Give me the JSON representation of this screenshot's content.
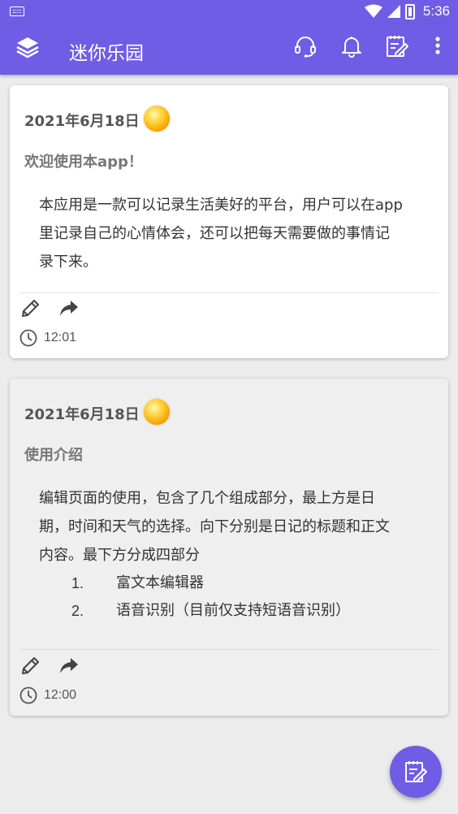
{
  "status_bar": {
    "time": "5:36"
  },
  "app_bar": {
    "title": "迷你乐园",
    "icons": [
      "layers-icon",
      "headset-icon",
      "bell-icon",
      "edit-note-icon",
      "more-vert-icon"
    ]
  },
  "colors": {
    "accent": "#6f5de6",
    "card_bg": "#ffffff",
    "page_bg": "#ececec"
  },
  "entries": [
    {
      "date": "2021年6月18日",
      "weather_icon": "sunny-icon",
      "title": "欢迎使用本app！",
      "body_lines": [
        "本应用是一款可以记录生活美好的平台，用户可以在app",
        "里记录自己的心情体会，还可以把每天需要做的事情记",
        "录下来。"
      ],
      "time": "12:01"
    },
    {
      "date": "2021年6月18日",
      "weather_icon": "sunny-icon",
      "title": "使用介绍",
      "body_lines": [
        "编辑页面的使用，包含了几个组成部分，最上方是日",
        "期，时间和天气的选择。向下分别是日记的标题和正文",
        "内容。最下方分成四部分"
      ],
      "list": [
        {
          "num": "1.",
          "text": "富文本编辑器"
        },
        {
          "num": "2.",
          "text": "语音识别（目前仅支持短语音识别）"
        }
      ],
      "time": "12:00"
    }
  ]
}
